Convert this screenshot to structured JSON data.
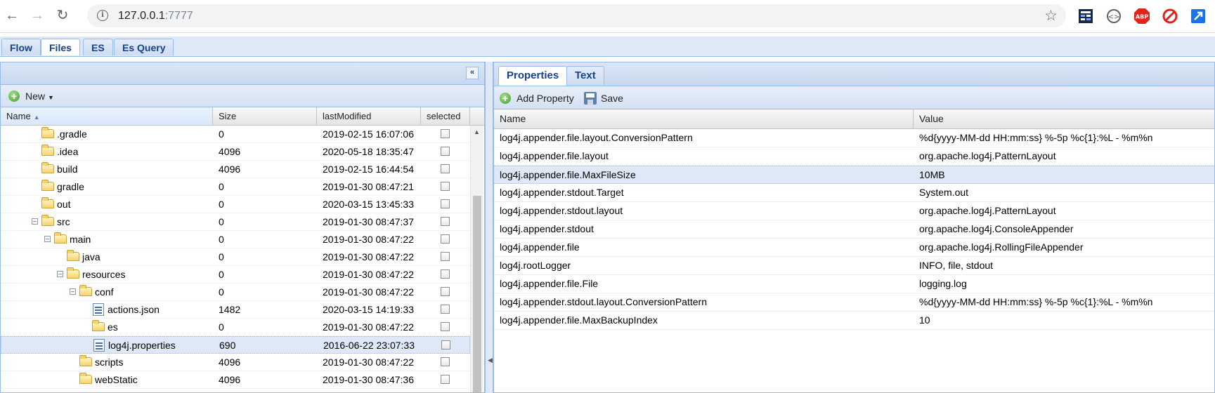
{
  "browser": {
    "url_host": "127.0.0.1",
    "url_port": ":7777",
    "extensions": [
      "sheet-icon",
      "code-icon",
      "adblock-icon",
      "block-icon",
      "resize-icon"
    ],
    "adblock_label": "ABP"
  },
  "app_tabs": [
    {
      "label": "Flow",
      "active": false
    },
    {
      "label": "Files",
      "active": true
    },
    {
      "label": "ES",
      "active": false
    },
    {
      "label": "Es Query",
      "active": false
    }
  ],
  "files": {
    "new_button": "New",
    "columns": {
      "name": "Name",
      "size": "Size",
      "modified": "lastModified",
      "selected": "selected"
    },
    "rows": [
      {
        "name": ".gradle",
        "size": "0",
        "modified": "2019-02-15 16:07:06",
        "type": "folder",
        "level": 0
      },
      {
        "name": ".idea",
        "size": "4096",
        "modified": "2020-05-18 18:35:47",
        "type": "folder",
        "level": 0
      },
      {
        "name": "build",
        "size": "4096",
        "modified": "2019-02-15 16:44:54",
        "type": "folder",
        "level": 0
      },
      {
        "name": "gradle",
        "size": "0",
        "modified": "2019-01-30 08:47:21",
        "type": "folder",
        "level": 0
      },
      {
        "name": "out",
        "size": "0",
        "modified": "2020-03-15 13:45:33",
        "type": "folder",
        "level": 0
      },
      {
        "name": "src",
        "size": "0",
        "modified": "2019-01-30 08:47:37",
        "type": "folder",
        "level": 0,
        "expanded": true
      },
      {
        "name": "main",
        "size": "0",
        "modified": "2019-01-30 08:47:22",
        "type": "folder",
        "level": 1,
        "expanded": true
      },
      {
        "name": "java",
        "size": "0",
        "modified": "2019-01-30 08:47:22",
        "type": "folder",
        "level": 2
      },
      {
        "name": "resources",
        "size": "0",
        "modified": "2019-01-30 08:47:22",
        "type": "folder",
        "level": 2,
        "expanded": true
      },
      {
        "name": "conf",
        "size": "0",
        "modified": "2019-01-30 08:47:22",
        "type": "folder",
        "level": 3,
        "expanded": true
      },
      {
        "name": "actions.json",
        "size": "1482",
        "modified": "2020-03-15 14:19:33",
        "type": "file",
        "level": 4
      },
      {
        "name": "es",
        "size": "0",
        "modified": "2019-01-30 08:47:22",
        "type": "folder",
        "level": 4
      },
      {
        "name": "log4j.properties",
        "size": "690",
        "modified": "2016-06-22 23:07:33",
        "type": "file",
        "level": 4,
        "selected": true
      },
      {
        "name": "scripts",
        "size": "4096",
        "modified": "2019-01-30 08:47:22",
        "type": "folder",
        "level": 3
      },
      {
        "name": "webStatic",
        "size": "4096",
        "modified": "2019-01-30 08:47:36",
        "type": "folder",
        "level": 3
      }
    ]
  },
  "properties": {
    "tabs": [
      {
        "label": "Properties",
        "active": true
      },
      {
        "label": "Text",
        "active": false
      }
    ],
    "add_button": "Add Property",
    "save_button": "Save",
    "columns": {
      "name": "Name",
      "value": "Value"
    },
    "rows": [
      {
        "name": "log4j.appender.file.layout.ConversionPattern",
        "value": "%d{yyyy-MM-dd HH:mm:ss} %-5p %c{1}:%L - %m%n"
      },
      {
        "name": "log4j.appender.file.layout",
        "value": "org.apache.log4j.PatternLayout"
      },
      {
        "name": "log4j.appender.file.MaxFileSize",
        "value": "10MB",
        "selected": true
      },
      {
        "name": "log4j.appender.stdout.Target",
        "value": "System.out"
      },
      {
        "name": "log4j.appender.stdout.layout",
        "value": "org.apache.log4j.PatternLayout"
      },
      {
        "name": "log4j.appender.stdout",
        "value": "org.apache.log4j.ConsoleAppender"
      },
      {
        "name": "log4j.appender.file",
        "value": "org.apache.log4j.RollingFileAppender"
      },
      {
        "name": "log4j.rootLogger",
        "value": "INFO, file, stdout"
      },
      {
        "name": "log4j.appender.file.File",
        "value": "logging.log"
      },
      {
        "name": "log4j.appender.stdout.layout.ConversionPattern",
        "value": "%d{yyyy-MM-dd HH:mm:ss} %-5p %c{1}:%L - %m%n"
      },
      {
        "name": "log4j.appender.file.MaxBackupIndex",
        "value": "10"
      }
    ]
  }
}
